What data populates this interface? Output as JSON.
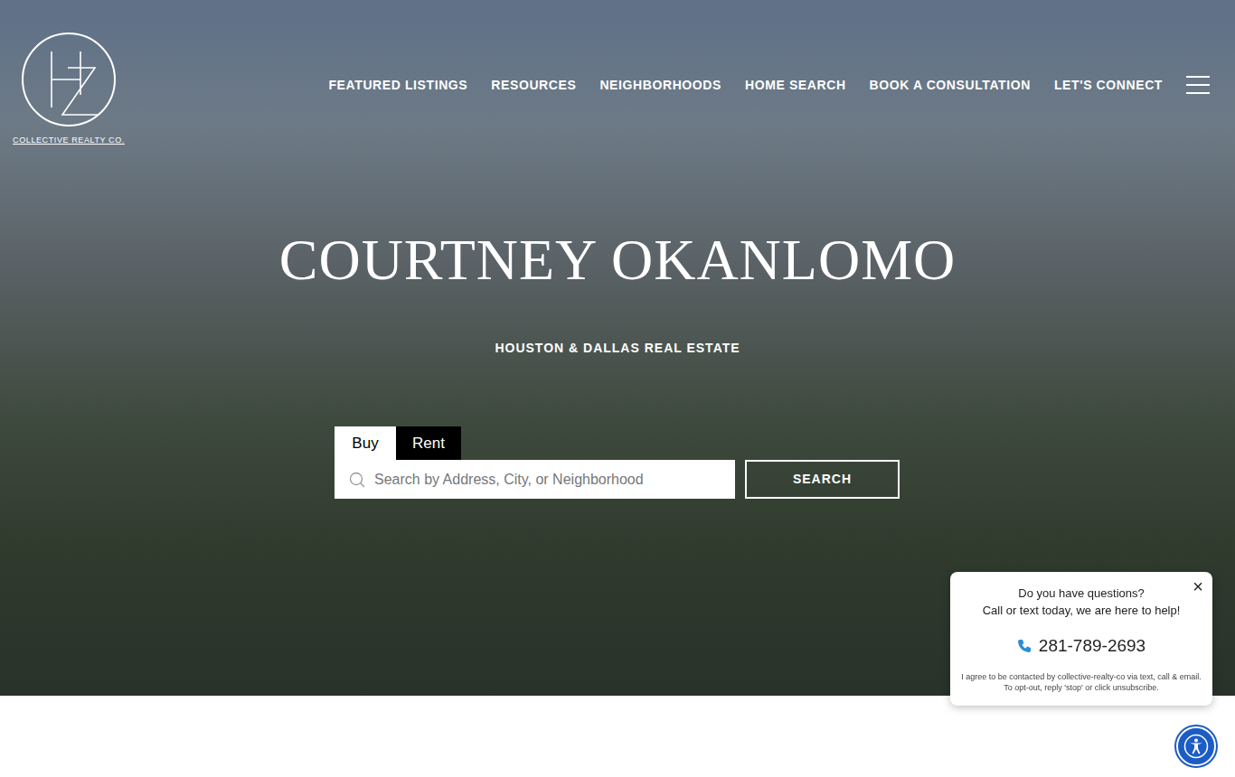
{
  "logo": {
    "text": "COLLECTIVE REALTY CO."
  },
  "nav": {
    "items": [
      "FEATURED LISTINGS",
      "RESOURCES",
      "NEIGHBORHOODS",
      "HOME SEARCH",
      "BOOK A CONSULTATION",
      "LET'S CONNECT"
    ]
  },
  "hero": {
    "title": "COURTNEY OKANLOMO",
    "subtitle": "HOUSTON & DALLAS REAL ESTATE"
  },
  "search": {
    "tabs": [
      {
        "label": "Buy",
        "selected": true
      },
      {
        "label": "Rent",
        "selected": false
      }
    ],
    "placeholder": "Search by Address, City, or Neighborhood",
    "button": "SEARCH"
  },
  "popup": {
    "close": "×",
    "heading": "Do you have questions?",
    "text": "Call or text today, we are here to help!",
    "phone": "281-789-2693",
    "consent": "I agree to be contacted by collective-realty-co via text, call & email. To opt-out, reply 'stop' or click unsubscribe."
  }
}
